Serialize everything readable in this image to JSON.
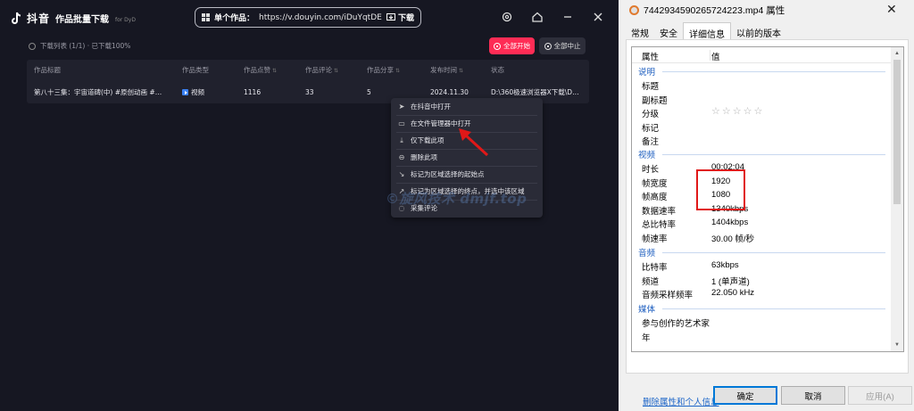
{
  "app": {
    "brand": "抖音",
    "subtitle": "作品批量下载",
    "for_label": "for DyD",
    "url_label": "单个作品：",
    "url_value": "https://v.douyin.com/iDuYqtDE/",
    "download_label": "下载",
    "list_info": "下载列表 (1/1) · 已下载100%",
    "start_all": "全部开始",
    "stop_all": "全部中止",
    "columns": [
      "作品标题",
      "作品类型",
      "作品点赞",
      "作品评论",
      "作品分享",
      "发布时间",
      "状态"
    ],
    "row": {
      "title": "第八十三集：宇宙道碑(中) #原创动画 #…",
      "type": "视频",
      "likes": "1116",
      "comments": "33",
      "shares": "5",
      "date": "2024.11.30",
      "status": "D:\\360极速浏览器X下载\\D…"
    },
    "context_menu": [
      {
        "icon": "send-icon",
        "label": "在抖音中打开"
      },
      {
        "icon": "folder-icon",
        "label": "在文件管理器中打开"
      },
      {
        "icon": "download-icon",
        "label": "仅下载此项"
      },
      {
        "icon": "minus-circle-icon",
        "label": "删除此项"
      },
      {
        "icon": "range-start-icon",
        "label": "标记为区域选择的起始点"
      },
      {
        "icon": "range-end-icon",
        "label": "标记为区域选择的终点，并选中该区域"
      },
      {
        "icon": "comment-icon",
        "label": "采集评论"
      }
    ],
    "watermark": "©旋风技术 dmjf.top",
    "accent_color": "#fe2c55"
  },
  "dialog": {
    "title": "7442934590265724223.mp4 属性",
    "tabs": [
      "常规",
      "安全",
      "详细信息",
      "以前的版本"
    ],
    "active_tab": "详细信息",
    "col_property": "属性",
    "col_value": "值",
    "sections": {
      "desc": "说明",
      "video": "视频",
      "audio": "音频",
      "media": "媒体"
    },
    "desc_rows": [
      "标题",
      "副标题",
      "分级",
      "标记",
      "备注"
    ],
    "rating_stars": "☆☆☆☆☆",
    "video_rows": [
      {
        "k": "时长",
        "v": "00:02:04"
      },
      {
        "k": "帧宽度",
        "v": "1920"
      },
      {
        "k": "帧高度",
        "v": "1080"
      },
      {
        "k": "数据速率",
        "v": "1340kbps"
      },
      {
        "k": "总比特率",
        "v": "1404kbps"
      },
      {
        "k": "帧速率",
        "v": "30.00 帧/秒"
      }
    ],
    "audio_rows": [
      {
        "k": "比特率",
        "v": "63kbps"
      },
      {
        "k": "频道",
        "v": "1 (单声道)"
      },
      {
        "k": "音频采样频率",
        "v": "22.050 kHz"
      }
    ],
    "media_rows": [
      "参与创作的艺术家",
      "年"
    ],
    "remove_link": "删除属性和个人信息",
    "ok": "确定",
    "cancel": "取消",
    "apply": "应用(A)"
  }
}
